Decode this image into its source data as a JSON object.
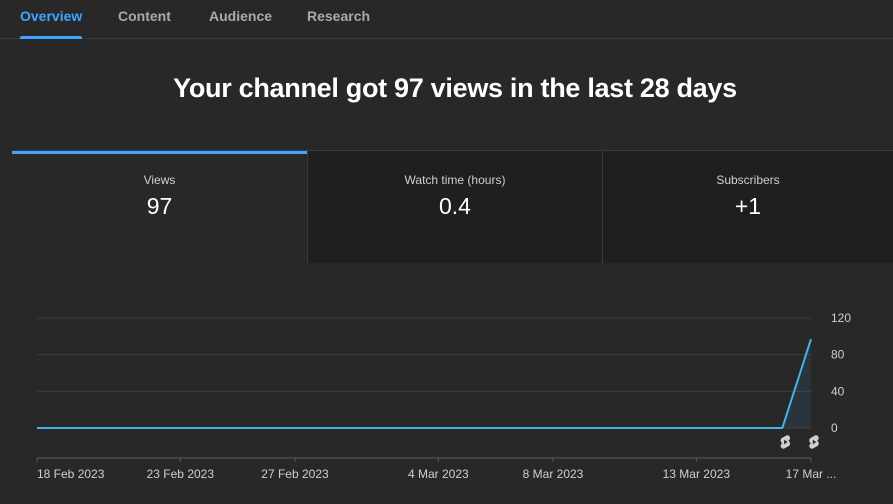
{
  "tabs": [
    {
      "label": "Overview",
      "active": true
    },
    {
      "label": "Content",
      "active": false
    },
    {
      "label": "Audience",
      "active": false
    },
    {
      "label": "Research",
      "active": false
    }
  ],
  "headline": "Your channel got 97 views in the last 28 days",
  "metrics": [
    {
      "label": "Views",
      "value": "97",
      "active": true
    },
    {
      "label": "Watch time (hours)",
      "value": "0.4",
      "active": false
    },
    {
      "label": "Subscribers",
      "value": "+1",
      "active": false
    }
  ],
  "colors": {
    "accent": "#3ea6ff",
    "line": "#41b4e8",
    "background": "#282828"
  },
  "chart_data": {
    "type": "line",
    "x": [
      "18 Feb 2023",
      "19 Feb 2023",
      "20 Feb 2023",
      "21 Feb 2023",
      "22 Feb 2023",
      "23 Feb 2023",
      "24 Feb 2023",
      "25 Feb 2023",
      "26 Feb 2023",
      "27 Feb 2023",
      "28 Feb 2023",
      "1 Mar 2023",
      "2 Mar 2023",
      "3 Mar 2023",
      "4 Mar 2023",
      "5 Mar 2023",
      "6 Mar 2023",
      "7 Mar 2023",
      "8 Mar 2023",
      "9 Mar 2023",
      "10 Mar 2023",
      "11 Mar 2023",
      "12 Mar 2023",
      "13 Mar 2023",
      "14 Mar 2023",
      "15 Mar 2023",
      "16 Mar 2023",
      "17 Mar 2023"
    ],
    "series": [
      {
        "values": [
          0,
          0,
          0,
          0,
          0,
          0,
          0,
          0,
          0,
          0,
          0,
          0,
          0,
          0,
          0,
          0,
          0,
          0,
          0,
          0,
          0,
          0,
          0,
          0,
          0,
          0,
          0,
          97
        ]
      }
    ],
    "y_ticks": [
      "0",
      "40",
      "80",
      "120"
    ],
    "ylim": [
      0,
      120
    ],
    "x_tick_labels": [
      {
        "label": "18 Feb 2023",
        "date": "18 Feb 2023"
      },
      {
        "label": "23 Feb 2023",
        "date": "23 Feb 2023"
      },
      {
        "label": "27 Feb 2023",
        "date": "27 Feb 2023"
      },
      {
        "label": "4 Mar 2023",
        "date": "4 Mar 2023"
      },
      {
        "label": "8 Mar 2023",
        "date": "8 Mar 2023"
      },
      {
        "label": "13 Mar 2023",
        "date": "13 Mar 2023"
      },
      {
        "label": "17 Mar ...",
        "date": "17 Mar 2023"
      }
    ],
    "markers": [
      {
        "date": "16 Mar 2023",
        "icon": "shorts-icon"
      },
      {
        "date": "17 Mar 2023",
        "icon": "shorts-icon"
      }
    ],
    "grid": true,
    "area_fill": true
  }
}
